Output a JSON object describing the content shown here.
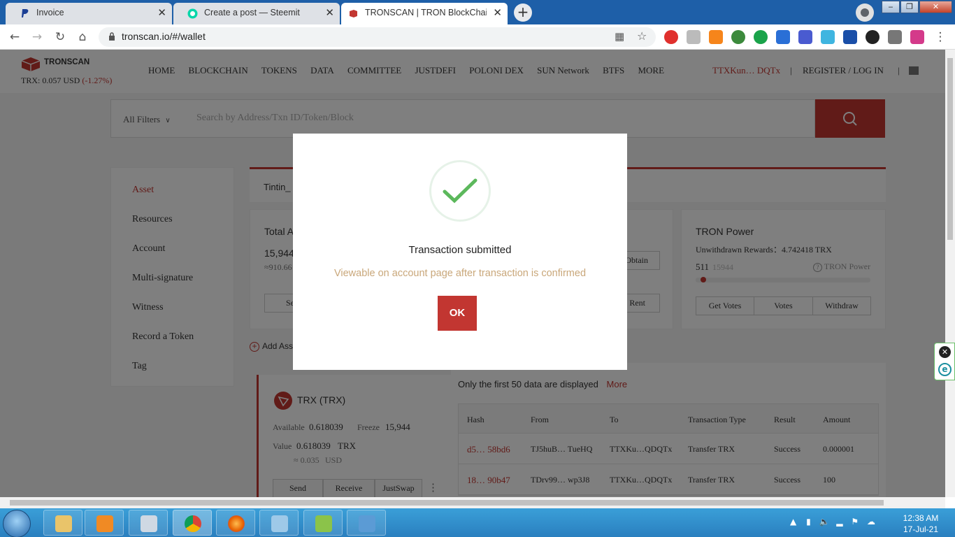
{
  "browser": {
    "tabs": [
      {
        "title": "Invoice"
      },
      {
        "title": "Create a post — Steemit"
      },
      {
        "title": "TRONSCAN | TRON BlockChain E"
      }
    ],
    "new_tab": "+",
    "url": "tronscan.io/#/wallet"
  },
  "site": {
    "logo": "TRONSCAN",
    "price_label": "TRX: 0.057 USD",
    "price_change": "(-1.27%)",
    "nav": [
      "HOME",
      "BLOCKCHAIN",
      "TOKENS",
      "DATA",
      "COMMITTEE",
      "JUSTDEFI",
      "POLONI DEX",
      "SUN Network",
      "BTFS",
      "MORE"
    ],
    "account": "TTXKun… DQTx",
    "separator": "|",
    "register": "REGISTER / LOG IN"
  },
  "search": {
    "filter": "All Filters",
    "placeholder": "Search by Address/Txn ID/Token/Block"
  },
  "sidebar": {
    "items": [
      "Asset",
      "Resources",
      "Account",
      "Multi-signature",
      "Witness",
      "Record a Token",
      "Tag"
    ]
  },
  "wallet": {
    "name": "Tintin_",
    "total_label": "Total A",
    "total_value": "15,944",
    "total_usd": "≈910.66",
    "send_partial": "Se",
    "obtain_btn": "Obtain",
    "rent_btn": "Rent"
  },
  "tron_power": {
    "title": "TRON Power",
    "rewards": "Unwithdrawn Rewards：4.742418 TRX",
    "used": "511",
    "total": "15944",
    "help_label": "TRON Power",
    "fill_fraction": 0.032,
    "buttons": [
      "Get Votes",
      "Votes",
      "Withdraw"
    ]
  },
  "add_asset": "Add Ass",
  "trx": {
    "name": "TRX (TRX)",
    "available_label": "Available",
    "available": "0.618039",
    "freeze_label": "Freeze",
    "freeze": "15,944",
    "value_label": "Value",
    "value": "0.618039",
    "value_unit": "TRX",
    "usd": "≈ 0.035",
    "usd_unit": "USD",
    "buttons": [
      "Send",
      "Receive",
      "JustSwap"
    ]
  },
  "transactions": {
    "note": "Only the first 50 data are displayed",
    "more": "More",
    "headers": [
      "Hash",
      "From",
      "To",
      "Transaction Type",
      "Result",
      "Amount"
    ],
    "rows": [
      [
        "d5… 58bd6",
        "TJ5huB…  TueHQ",
        "TTXKu…QDQTx",
        "Transfer TRX",
        "Success",
        "0.000001"
      ],
      [
        "18… 90b47",
        "TDrv99…  wp3J8",
        "TTXKu…QDQTx",
        "Transfer TRX",
        "Success",
        "100"
      ]
    ]
  },
  "modal": {
    "title": "Transaction submitted",
    "subtitle": "Viewable on account page after transaction is confirmed",
    "ok": "OK"
  },
  "taskbar": {
    "time": "12:38 AM",
    "date": "17-Jul-21"
  },
  "colors": {
    "brand_red": "#c23631",
    "success_green": "#5cb85c",
    "chrome_blue": "#1e5fa8"
  }
}
